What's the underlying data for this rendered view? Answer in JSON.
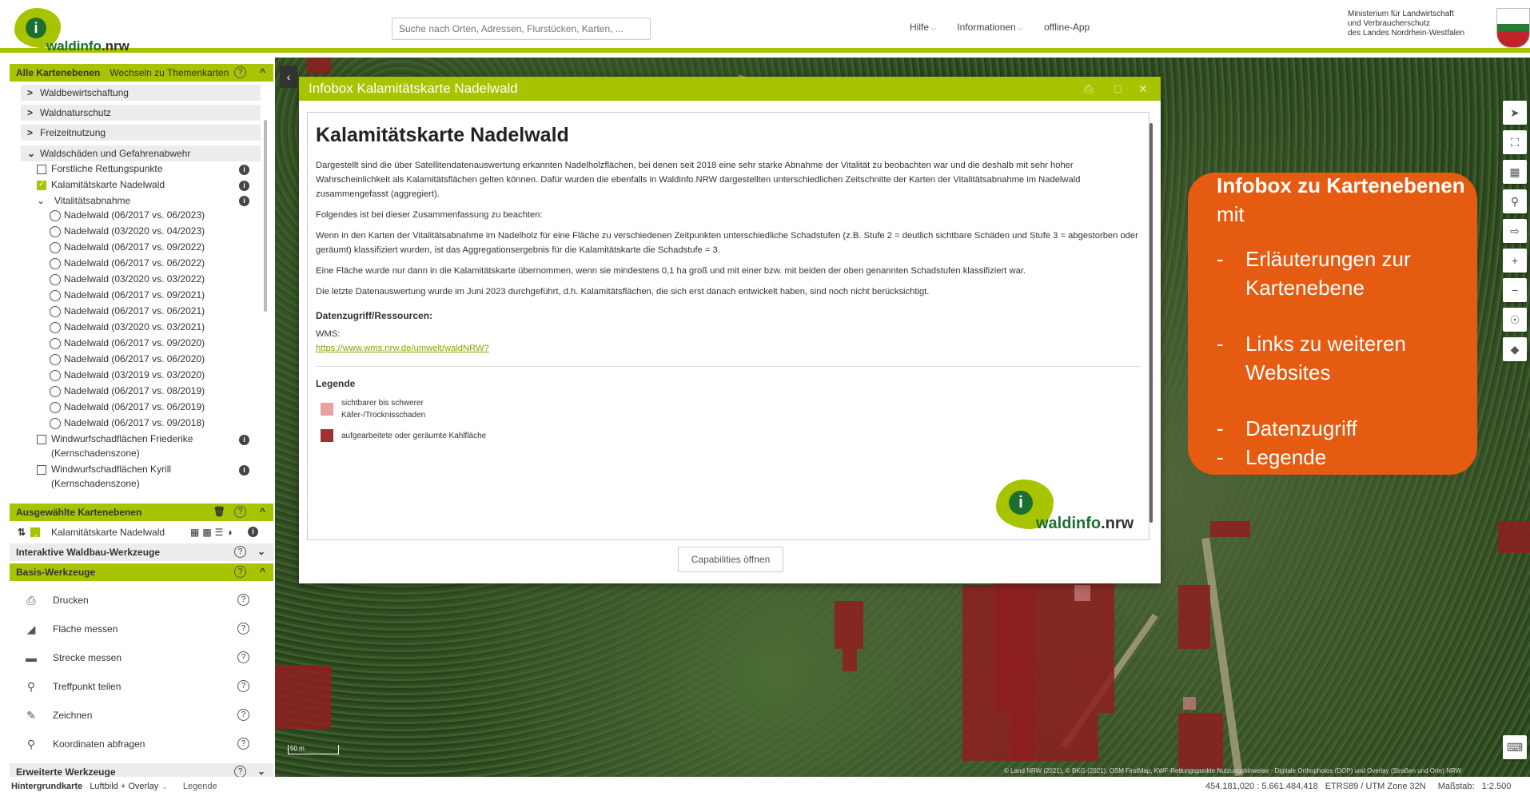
{
  "header": {
    "logo_prefix": "waldinfo",
    "logo_suffix": ".nrw",
    "search_placeholder": "Suche nach Orten, Adressen, Flurstücken, Karten, ...",
    "nav": [
      "Hilfe",
      "Informationen",
      "offline-App"
    ],
    "ministry": [
      "Ministerium für Landwirtschaft",
      "und Verbraucherschutz",
      "des Landes Nordrhein-Westfalen"
    ]
  },
  "sidebar": {
    "all_layers": {
      "title": "Alle Kartenebenen",
      "switch": "Wechseln zu Themenkarten"
    },
    "groups": [
      "Waldbewirtschaftung",
      "Waldnaturschutz",
      "Freizeitnutzung",
      "Waldschäden und Gefahrenabwehr"
    ],
    "items": [
      {
        "label": "Forstliche Rettungspunkte",
        "checked": false
      },
      {
        "label": "Kalamitätskarte Nadelwald",
        "checked": true
      }
    ],
    "vitality_group": "Vitalitätsabnahme",
    "vitality_items": [
      "Nadelwald (06/2017 vs. 06/2023)",
      "Nadelwald (03/2020 vs. 04/2023)",
      "Nadelwald (06/2017 vs. 09/2022)",
      "Nadelwald (06/2017 vs. 06/2022)",
      "Nadelwald (03/2020 vs. 03/2022)",
      "Nadelwald (06/2017 vs. 09/2021)",
      "Nadelwald (06/2017 vs. 06/2021)",
      "Nadelwald (03/2020 vs. 03/2021)",
      "Nadelwald (06/2017 vs. 09/2020)",
      "Nadelwald (06/2017 vs. 06/2020)",
      "Nadelwald (03/2019 vs. 03/2020)",
      "Nadelwald (06/2017 vs. 08/2019)",
      "Nadelwald (06/2017 vs. 06/2019)",
      "Nadelwald (06/2017 vs. 09/2018)"
    ],
    "windthrow": [
      {
        "label": "Windwurfschadflächen Friederike",
        "sub": "(Kernschadenszone)"
      },
      {
        "label": "Windwurfschadflächen Kyrill",
        "sub": "(Kernschadenszone)"
      }
    ],
    "selected_title": "Ausgewählte Kartenebenen",
    "selected_layer": "Kalamitätskarte Nadelwald",
    "interactive_title": "Interaktive Waldbau-Werkzeuge",
    "basis_title": "Basis-Werkzeuge",
    "tools": [
      "Drucken",
      "Fläche messen",
      "Strecke messen",
      "Treffpunkt teilen",
      "Zeichnen",
      "Koordinaten abfragen"
    ],
    "extended_title": "Erweiterte Werkzeuge"
  },
  "infobox": {
    "title": "Infobox Kalamitätskarte Nadelwald",
    "heading": "Kalamitätskarte Nadelwald",
    "paragraphs": [
      "Dargestellt sind die über Satellitendatenauswertung erkannten Nadelholzflächen, bei denen seit 2018 eine sehr starke Abnahme der Vitalität zu beobachten war und die deshalb mit sehr hoher Wahrscheinlichkeit als Kalamitätsflächen gelten können. Dafür wurden die ebenfalls in Waldinfo.NRW dargestellten unterschiedlichen Zeitschnitte der Karten der Vitalitätsabnahme im Nadelwald zusammengefasst (aggregiert).",
      "Folgendes ist bei dieser Zusammenfassung zu beachten:",
      "Wenn in den Karten der Vitalitätsabnahme im Nadelholz für eine Fläche zu verschiedenen Zeitpunkten unterschiedliche Schadstufen (z.B. Stufe 2 = deutlich sichtbare Schäden und Stufe 3 = abgestorben oder geräumt) klassifiziert wurden, ist das Aggregationsergebnis für die Kalamitätskarte die Schadstufe = 3.",
      "Eine Fläche wurde nur dann in die Kalamitätskarte übernommen, wenn sie mindestens 0,1 ha groß und mit einer bzw. mit beiden der oben genannten Schadstufen klassifiziert war.",
      "Die letzte Datenauswertung wurde im Juni 2023 durchgeführt, d.h. Kalamitätsflächen, die sich erst danach entwickelt haben, sind noch nicht berücksichtigt."
    ],
    "data_access_title": "Datenzugriff/Ressourcen:",
    "wms_label": "WMS:",
    "wms_url": "https://www.wms.nrw.de/umwelt/waldNRW?",
    "legend_title": "Legende",
    "legend": [
      {
        "label1": "sichtbarer bis schwerer",
        "label2": "Käfer-/Trocknisschaden",
        "color": "#e8a0a0"
      },
      {
        "label1": "aufgearbeitete oder geräumte Kahlfläche",
        "label2": "",
        "color": "#a03030"
      }
    ],
    "capabilities_button": "Capabilities öffnen"
  },
  "callout": {
    "title_bold": "Infobox zu Kartenebenen",
    "title_rest": " mit",
    "items": [
      "Erläuterungen zur Kartenebene",
      "Links zu weiteren Websites",
      "Datenzugriff",
      "Legende"
    ]
  },
  "map": {
    "attribution": "© Land NRW (2021), © BKG (2021), OSM FirstMap, KWF-Rettungspunkte Nutzungshinweise  ·  Digitale Orthophotos (DOP) und Overlay (Straßen und Orte) NRW",
    "scale_label": "50 m"
  },
  "footer": {
    "basemap_label": "Hintergrundkarte",
    "basemap_value": "Luftbild + Overlay",
    "legend_link": "Legende",
    "coords": "454.181,020 : 5.661.484,418",
    "crs": "ETRS89 / UTM Zone 32N",
    "scale_label": "Maßstab:",
    "scale_value": "1:2.500"
  },
  "colors": {
    "accent": "#a8c400",
    "callout": "#e55b12",
    "damage": "#8e1e1e"
  }
}
